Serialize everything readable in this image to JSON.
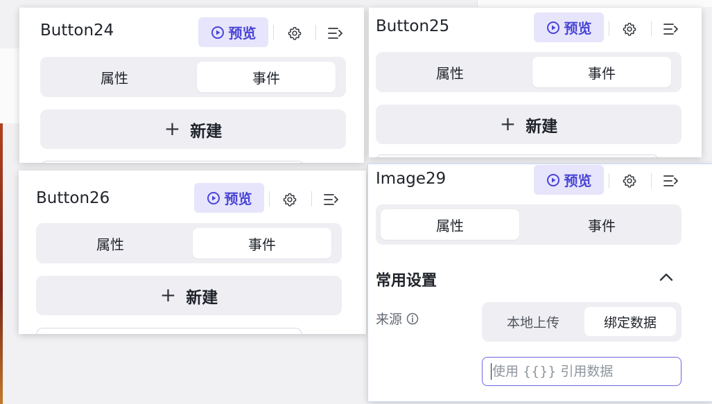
{
  "panels": [
    {
      "title": "Button24",
      "preview": "预览",
      "tabs": [
        "属性",
        "事件"
      ],
      "active_tab": 1,
      "new_label": "新建"
    },
    {
      "title": "Button25",
      "preview": "预览",
      "tabs": [
        "属性",
        "事件"
      ],
      "active_tab": 1,
      "new_label": "新建"
    },
    {
      "title": "Button26",
      "preview": "预览",
      "tabs": [
        "属性",
        "事件"
      ],
      "active_tab": 1,
      "new_label": "新建"
    },
    {
      "title": "Image29",
      "preview": "预览",
      "tabs": [
        "属性",
        "事件"
      ],
      "active_tab": 0,
      "section": "常用设置",
      "source_label": "来源",
      "source_options": [
        "本地上传",
        "绑定数据"
      ],
      "source_selected": 1,
      "input_placeholder": "使用 {{}} 引用数据"
    }
  ],
  "icons": {
    "preview": "play-circle-icon",
    "settings": "gear-icon",
    "collapse": "collapse-right-icon",
    "section": "chevron-up-icon",
    "info": "info-icon",
    "new": "plus-icon"
  },
  "colors": {
    "accent": "#4a44d6",
    "accent_bg": "#e6e5fb",
    "tab_bg": "#eeeef3"
  }
}
